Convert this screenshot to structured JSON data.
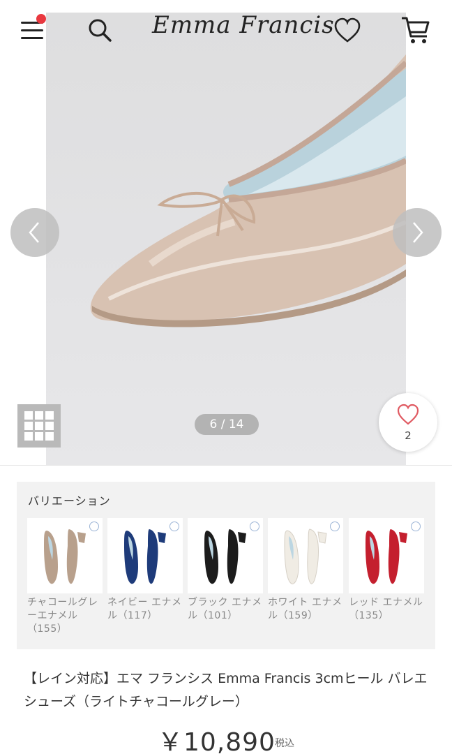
{
  "header": {
    "brand": "Emma Francis"
  },
  "gallery": {
    "counter": "6 / 14",
    "favorite_count": "2"
  },
  "variations": {
    "title": "バリエーション",
    "items": [
      {
        "label": "チャコールグレーエナメル（155）",
        "color": "#b8a08c"
      },
      {
        "label": "ネイビー エナメル（117）",
        "color": "#1e3b7a"
      },
      {
        "label": "ブラック エナメル（101）",
        "color": "#1c1c1c"
      },
      {
        "label": "ホワイト エナメル（159）",
        "color": "#f0ece4"
      },
      {
        "label": "レッド エナメル（135）",
        "color": "#c41f2e"
      }
    ]
  },
  "product": {
    "title": "【レイン対応】エマ フランシス Emma Francis 3cmヒール バレエシューズ（ライトチャコールグレー）",
    "price": "￥10,890",
    "tax_note": "税込"
  },
  "colors": {
    "notification": "#e9383f",
    "heart": "#e05a62"
  }
}
